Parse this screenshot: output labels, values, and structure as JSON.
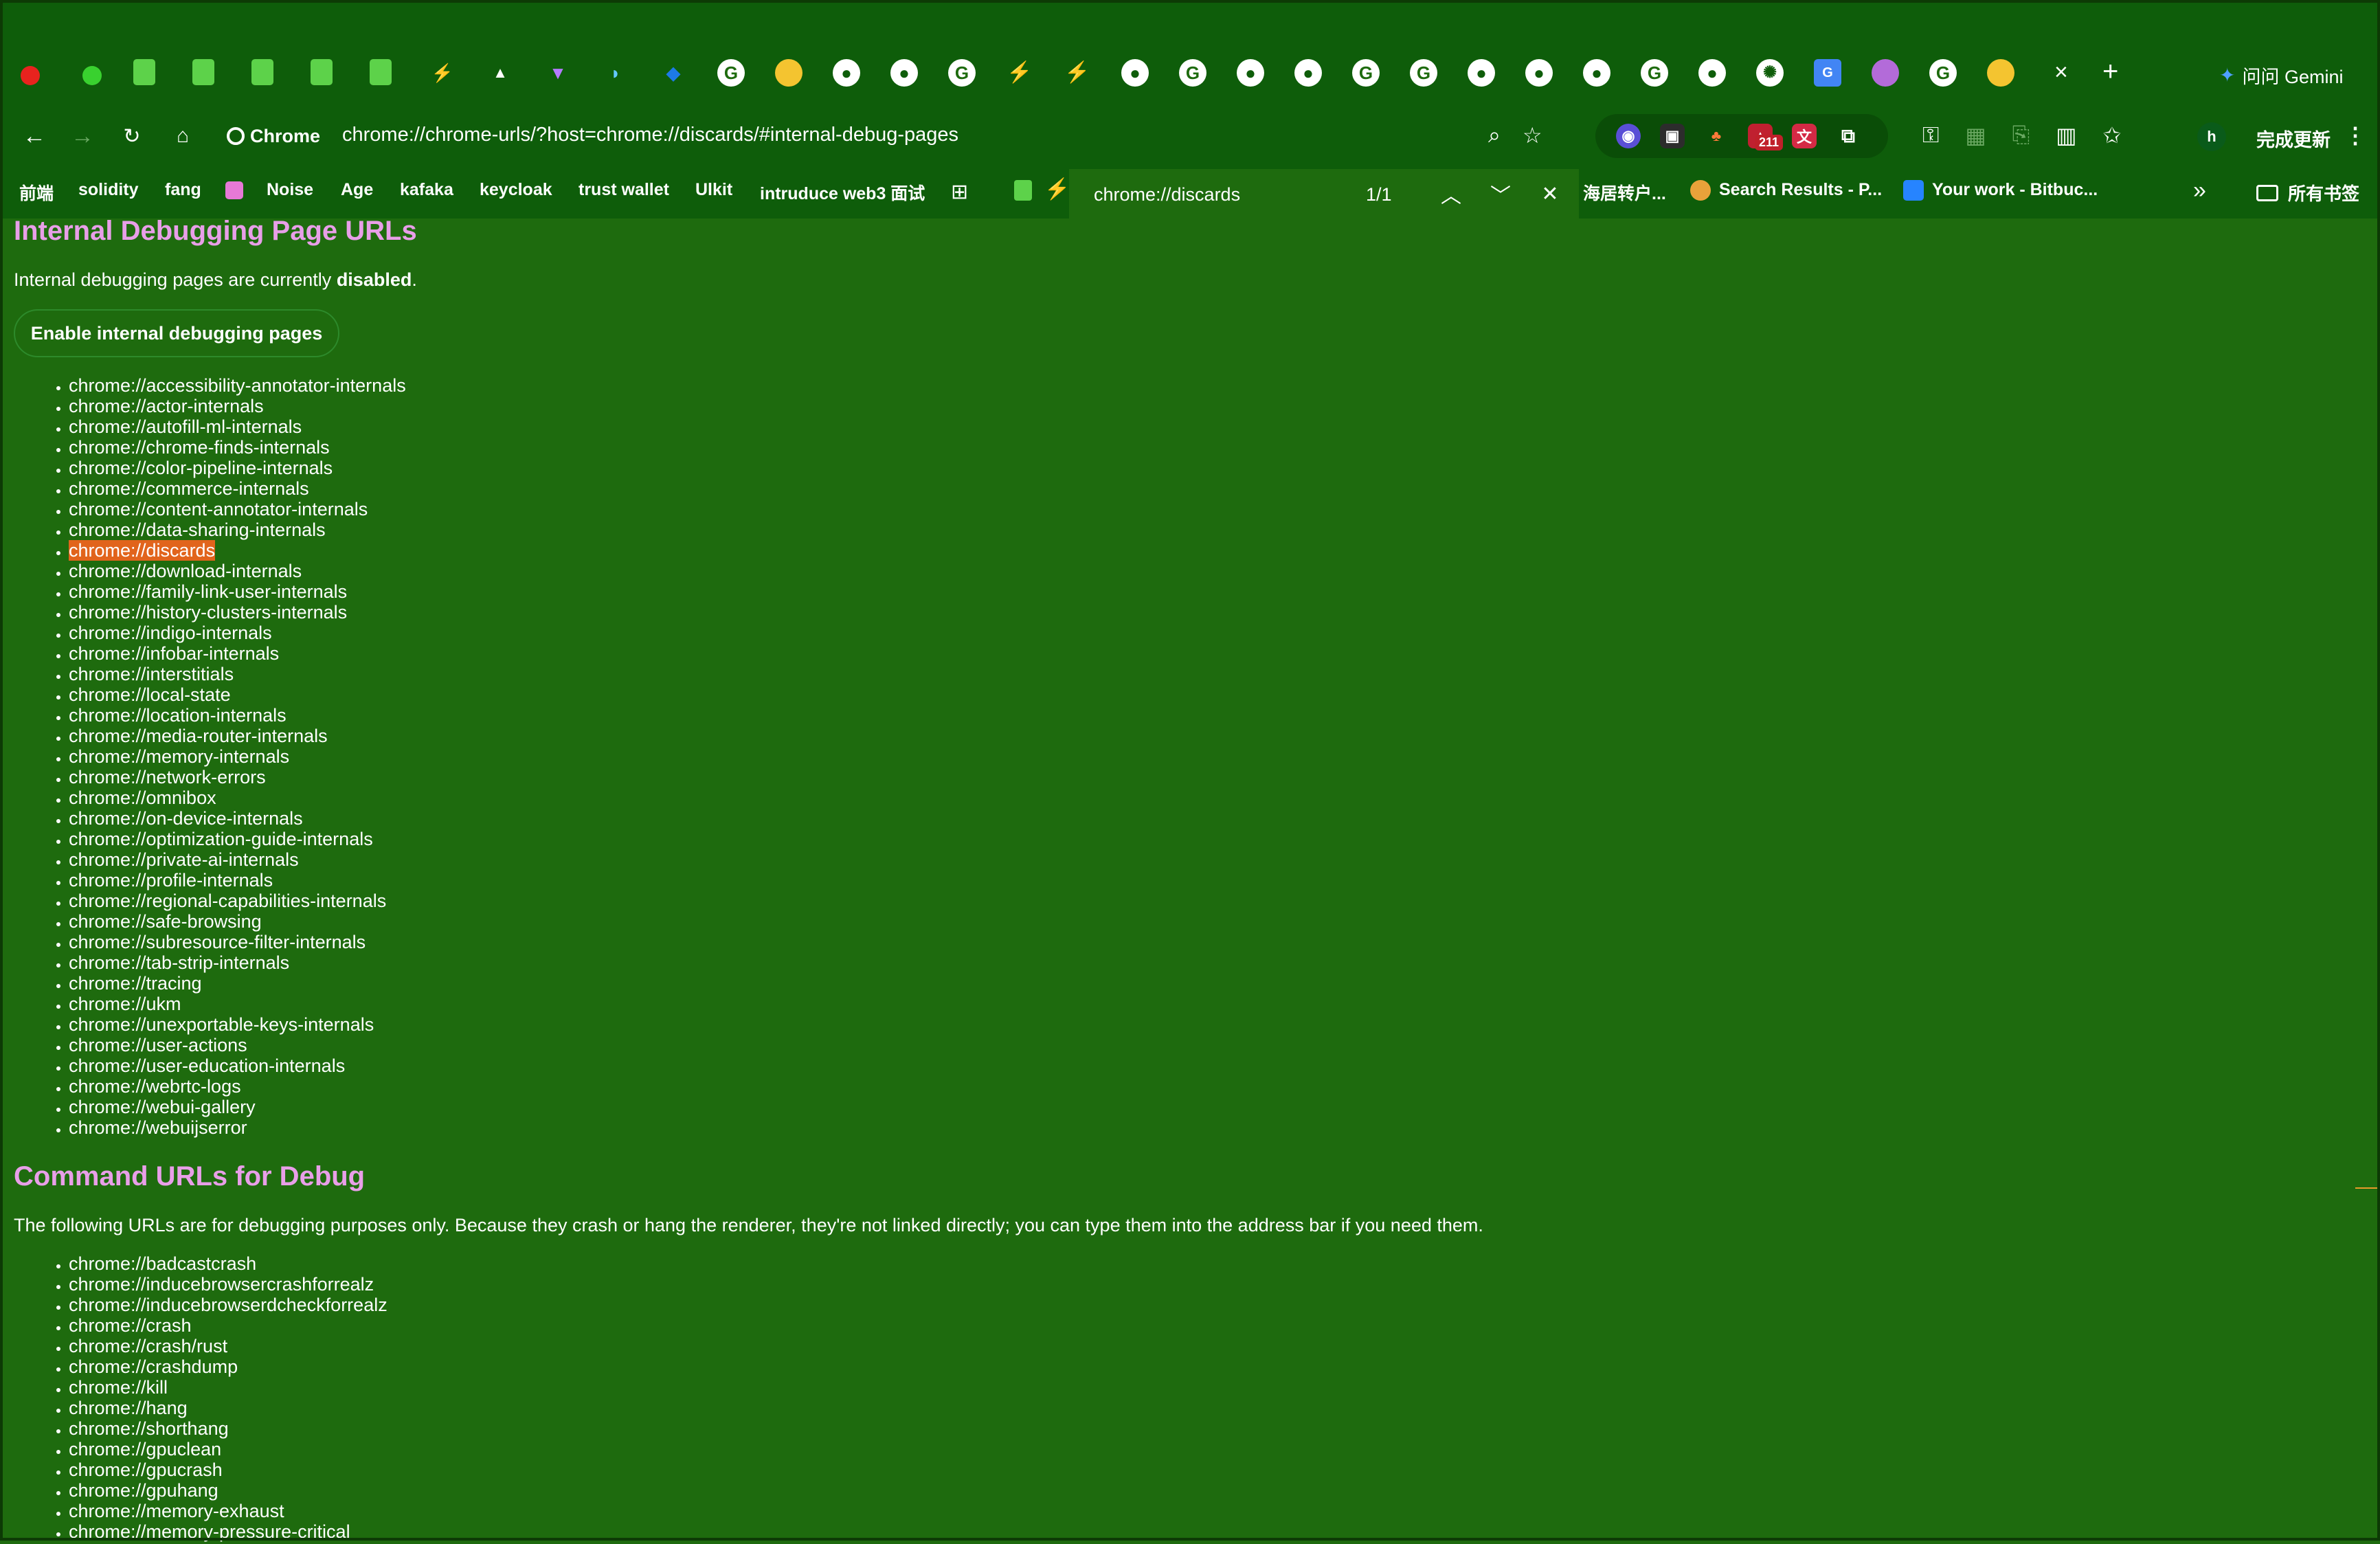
{
  "window": {
    "gemini_label": "问问 Gemini",
    "new_tab": "+",
    "close_tab": "×"
  },
  "toolbar": {
    "chip_label": "Chrome",
    "url": "chrome://chrome-urls/?host=chrome://discards/#internal-debug-pages",
    "ext_badge": "211",
    "update_label": "完成更新",
    "profile_initial": "h"
  },
  "bookmarks": {
    "items": [
      "前端",
      "solidity",
      "fang",
      "Noise",
      "Age",
      "kafaka",
      "keycloak",
      "trust wallet",
      "Ulkit",
      "intruduce web3 面试"
    ],
    "right_items": [
      "海居转户...",
      "Search Results - P...",
      "Your work - Bitbuc..."
    ],
    "folder_label": "所有书签"
  },
  "findbar": {
    "query": "chrome://discards",
    "count": "1/1"
  },
  "page": {
    "title": "Internal Debugging Page URLs",
    "status_prefix": "Internal debugging pages are currently ",
    "status_value": "disabled",
    "status_suffix": ".",
    "enable_button": "Enable internal debugging pages",
    "highlighted_url": "chrome://discards",
    "internal_urls": [
      "chrome://accessibility-annotator-internals",
      "chrome://actor-internals",
      "chrome://autofill-ml-internals",
      "chrome://chrome-finds-internals",
      "chrome://color-pipeline-internals",
      "chrome://commerce-internals",
      "chrome://content-annotator-internals",
      "chrome://data-sharing-internals",
      "chrome://discards",
      "chrome://download-internals",
      "chrome://family-link-user-internals",
      "chrome://history-clusters-internals",
      "chrome://indigo-internals",
      "chrome://infobar-internals",
      "chrome://interstitials",
      "chrome://local-state",
      "chrome://location-internals",
      "chrome://media-router-internals",
      "chrome://memory-internals",
      "chrome://network-errors",
      "chrome://omnibox",
      "chrome://on-device-internals",
      "chrome://optimization-guide-internals",
      "chrome://private-ai-internals",
      "chrome://profile-internals",
      "chrome://regional-capabilities-internals",
      "chrome://safe-browsing",
      "chrome://subresource-filter-internals",
      "chrome://tab-strip-internals",
      "chrome://tracing",
      "chrome://ukm",
      "chrome://unexportable-keys-internals",
      "chrome://user-actions",
      "chrome://user-education-internals",
      "chrome://webrtc-logs",
      "chrome://webui-gallery",
      "chrome://webuijserror"
    ],
    "debug_title": "Command URLs for Debug",
    "debug_description": "The following URLs are for debugging purposes only. Because they crash or hang the renderer, they're not linked directly; you can type them into the address bar if you need them.",
    "debug_urls": [
      "chrome://badcastcrash",
      "chrome://inducebrowsercrashforrealz",
      "chrome://inducebrowserdcheckforrealz",
      "chrome://crash",
      "chrome://crash/rust",
      "chrome://crashdump",
      "chrome://kill",
      "chrome://hang",
      "chrome://shorthang",
      "chrome://gpuclean",
      "chrome://gpucrash",
      "chrome://gpuhang",
      "chrome://memory-exhaust",
      "chrome://memory-pressure-critical"
    ]
  },
  "colors": {
    "background": "#1e6b0e",
    "chrome": "#0e5d0a",
    "heading": "#e89fe8",
    "highlight": "#e1641c"
  },
  "icons": {
    "tabs": [
      "page-icon",
      "page-icon",
      "page-icon",
      "page-icon",
      "page-icon",
      "bolt-icon",
      "triangle-icon",
      "vite-icon",
      "wave-icon",
      "bird-icon",
      "google-icon",
      "chrome-icon",
      "github-icon",
      "github-icon",
      "google-icon",
      "bolt-icon",
      "bolt-icon",
      "github-icon",
      "google-icon",
      "github-icon",
      "github-icon",
      "google-icon",
      "google-icon",
      "github-icon",
      "github-icon",
      "github-icon",
      "google-icon",
      "github-icon",
      "openai-icon",
      "translate-icon",
      "octocat-icon",
      "google-icon",
      "chrome-icon"
    ]
  }
}
